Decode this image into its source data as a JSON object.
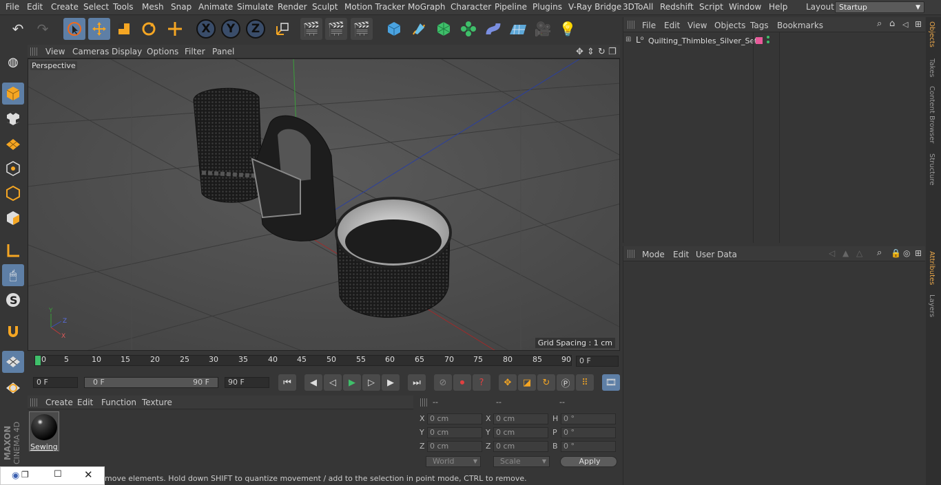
{
  "menu": [
    "File",
    "Edit",
    "Create",
    "Select",
    "Tools",
    "Mesh",
    "Snap",
    "Animate",
    "Simulate",
    "Render",
    "Sculpt",
    "Motion Tracker",
    "MoGraph",
    "Character",
    "Pipeline",
    "Plugins",
    "V-Ray Bridge",
    "3DToAll",
    "Redshift",
    "Script",
    "Window",
    "Help"
  ],
  "layout": {
    "label": "Layout:",
    "value": "Startup"
  },
  "viewport": {
    "menu": [
      "View",
      "Cameras",
      "Display",
      "Options",
      "Filter",
      "Panel"
    ],
    "label": "Perspective",
    "grid_spacing": "Grid Spacing : 1 cm"
  },
  "timeline": {
    "ticks": [
      "0",
      "5",
      "10",
      "15",
      "20",
      "25",
      "30",
      "35",
      "40",
      "45",
      "50",
      "55",
      "60",
      "65",
      "70",
      "75",
      "80",
      "85",
      "90"
    ],
    "current_frame": "0 F"
  },
  "transport": {
    "start": "0 F",
    "range_start": "0 F",
    "range_end": "90 F",
    "end": "90 F"
  },
  "materials": {
    "menu": [
      "Create",
      "Edit",
      "Function",
      "Texture"
    ],
    "item": "Sewing"
  },
  "coords": {
    "headers": [
      "--",
      "--",
      "--"
    ],
    "rows": [
      {
        "l1": "X",
        "v1": "0 cm",
        "l2": "X",
        "v2": "0 cm",
        "l3": "H",
        "v3": "0 °"
      },
      {
        "l1": "Y",
        "v1": "0 cm",
        "l2": "Y",
        "v2": "0 cm",
        "l3": "P",
        "v3": "0 °"
      },
      {
        "l1": "Z",
        "v1": "0 cm",
        "l2": "Z",
        "v2": "0 cm",
        "l3": "B",
        "v3": "0 °"
      }
    ],
    "world": "World",
    "scale": "Scale",
    "apply": "Apply"
  },
  "status": "move elements. Hold down SHIFT to quantize movement / add to the selection in point mode, CTRL to remove.",
  "objects": {
    "menu": [
      "File",
      "Edit",
      "View",
      "Objects",
      "Tags",
      "Bookmarks"
    ],
    "items": [
      "Quilting_Thimbles_Silver_Set"
    ]
  },
  "attributes": {
    "menu": [
      "Mode",
      "Edit",
      "User Data"
    ]
  },
  "right_tabs": [
    "Objects",
    "Takes",
    "Content Browser",
    "Structure",
    "Attributes",
    "Layers"
  ],
  "brand": {
    "line1": "MAXON",
    "line2": "CINEMA 4D"
  }
}
